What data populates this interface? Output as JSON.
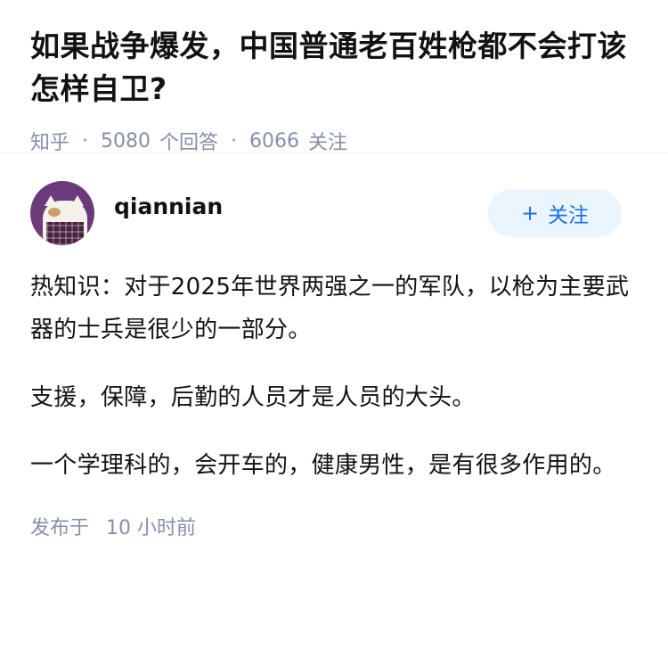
{
  "question": {
    "title": "如果战争爆发，中国普通老百姓枪都不会打该怎样自卫?",
    "source": "知乎",
    "answer_count": "5080",
    "answer_label": "个回答",
    "follower_count": "6066",
    "follower_label": "关注"
  },
  "author": {
    "name": "qiannian",
    "follow_label": "关注",
    "follow_icon": "+"
  },
  "answer": {
    "paragraphs": [
      "热知识：对于2025年世界两强之一的军队，以枪为主要武器的士兵是很少的一部分。",
      "支援，保障，后勤的人员才是人员的大头。",
      "一个学理科的，会开车的，健康男性，是有很多作用的。"
    ],
    "published_label": "发布于",
    "published_time": "10 小时前"
  },
  "colors": {
    "meta_gray": "#8590a6",
    "accent_blue": "#1772f6",
    "follow_bg": "#ebf5fd",
    "avatar_bg": "#6b3a78"
  }
}
